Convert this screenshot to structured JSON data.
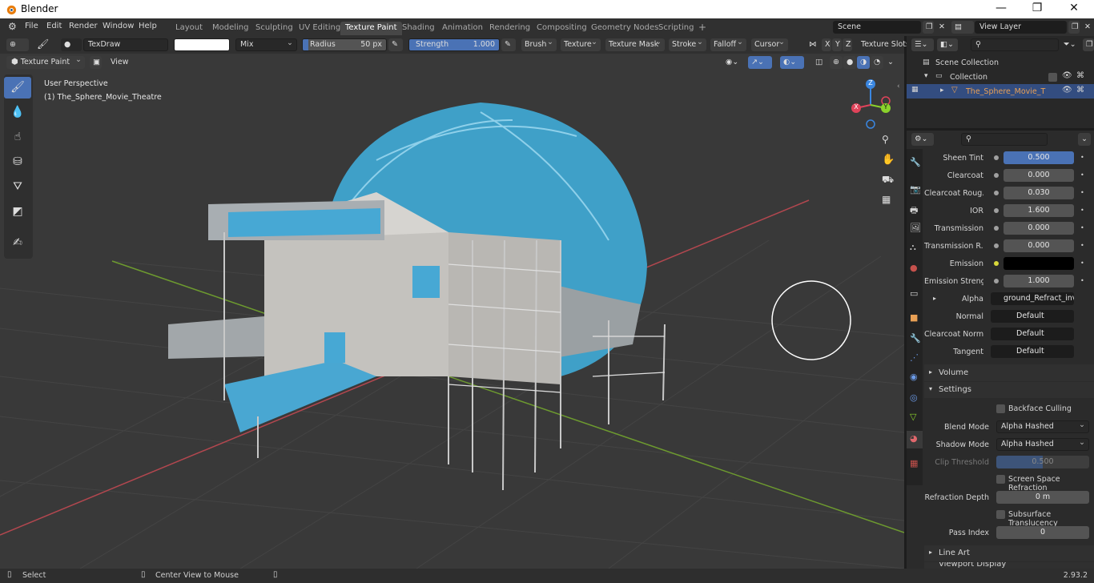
{
  "window": {
    "title": "Blender",
    "minimize": "—",
    "maximize": "❐",
    "close": "✕"
  },
  "menu": [
    "File",
    "Edit",
    "Render",
    "Window",
    "Help"
  ],
  "workspaces": [
    {
      "label": "Layout"
    },
    {
      "label": "Modeling"
    },
    {
      "label": "Sculpting"
    },
    {
      "label": "UV Editing"
    },
    {
      "label": "Texture Paint",
      "active": true
    },
    {
      "label": "Shading"
    },
    {
      "label": "Animation"
    },
    {
      "label": "Rendering"
    },
    {
      "label": "Compositing"
    },
    {
      "label": "Geometry Nodes"
    },
    {
      "label": "Scripting"
    }
  ],
  "add_workspace": "+",
  "scene": {
    "name": "Scene",
    "view_layer": "View Layer"
  },
  "tool_header": {
    "brush_name": "TexDraw",
    "blend": "Mix",
    "radius_label": "Radius",
    "radius_value": "50 px",
    "strength_label": "Strength",
    "strength_value": "1.000",
    "menus": [
      "Brush",
      "Texture",
      "Texture Mask",
      "Stroke",
      "Falloff",
      "Cursor"
    ],
    "axes": [
      "X",
      "Y",
      "Z"
    ],
    "texture_slots": "Texture Slots"
  },
  "header2": {
    "mode": "Texture Paint",
    "view": "View"
  },
  "viewport": {
    "perspective": "User Perspective",
    "object": "(1) The_Sphere_Movie_Theatre"
  },
  "gizmo": {
    "x": "X",
    "y": "Y",
    "z": "Z"
  },
  "outliner": {
    "collection_root": "Scene Collection",
    "collection": "Collection",
    "object": "The_Sphere_Movie_Theatre"
  },
  "properties": {
    "rows": [
      {
        "label": "Sheen Tint",
        "value": "0.500",
        "highlight": true
      },
      {
        "label": "Clearcoat",
        "value": "0.000"
      },
      {
        "label": "Clearcoat Roug...",
        "value": "0.030"
      },
      {
        "label": "IOR",
        "value": "1.600"
      },
      {
        "label": "Transmission",
        "value": "0.000"
      },
      {
        "label": "Transmission R...",
        "value": "0.000"
      },
      {
        "label": "Emission",
        "value": ""
      },
      {
        "label": "Emission Streng...",
        "value": "1.000"
      },
      {
        "label": "Alpha",
        "value": "ground_Refract_inv..."
      },
      {
        "label": "Normal",
        "value": "Default"
      },
      {
        "label": "Clearcoat Normal",
        "value": "Default"
      },
      {
        "label": "Tangent",
        "value": "Default"
      }
    ],
    "volume_panel": "Volume",
    "settings_panel": "Settings",
    "backface_culling": "Backface Culling",
    "blend_mode_label": "Blend Mode",
    "blend_mode_value": "Alpha Hashed",
    "shadow_mode_label": "Shadow Mode",
    "shadow_mode_value": "Alpha Hashed",
    "clip_threshold_label": "Clip Threshold",
    "clip_threshold_value": "0.500",
    "screen_space_refraction": "Screen Space Refraction",
    "refraction_depth_label": "Refraction Depth",
    "refraction_depth_value": "0 m",
    "subsurface_translucency": "Subsurface Translucency",
    "pass_index_label": "Pass Index",
    "pass_index_value": "0",
    "line_art_panel": "Line Art",
    "viewport_display_panel": "Viewport Display"
  },
  "status": {
    "select": "Select",
    "center": "Center View to Mouse",
    "version": "2.93.2"
  },
  "colors": {
    "accent": "#4a72b5",
    "active_object": "#e8a055",
    "x_axis": "#e0435a",
    "y_axis": "#8bd22b",
    "z_axis": "#3a86e0"
  }
}
